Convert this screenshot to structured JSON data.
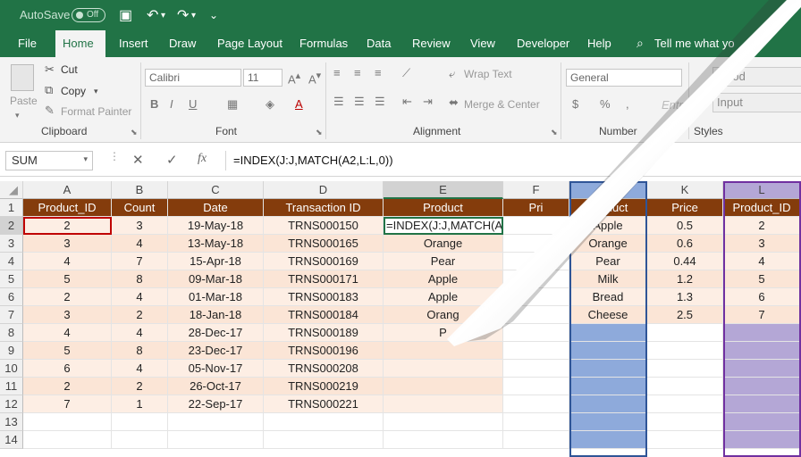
{
  "titlebar": {
    "autosave": "AutoSave",
    "toggle": "Off"
  },
  "tabs": [
    "File",
    "Home",
    "Insert",
    "Draw",
    "Page Layout",
    "Formulas",
    "Data",
    "Review",
    "View",
    "Developer",
    "Help",
    "Tell me what yo"
  ],
  "clipboard": {
    "paste": "Paste",
    "cut": "Cut",
    "copy": "Copy",
    "format_painter": "Format Painter",
    "label": "Clipboard"
  },
  "font": {
    "name": "Calibri",
    "size": "11",
    "label": "Font"
  },
  "alignment": {
    "wrap": "Wrap Text",
    "merge": "Merge & Center",
    "label": "Alignment"
  },
  "number": {
    "format": "General",
    "label": "Number"
  },
  "styles": {
    "good": "Good",
    "input": "Input",
    "label": "Styles",
    "tray": "Entry"
  },
  "formula_bar": {
    "name_box": "SUM",
    "formula": "=INDEX(J:J,MATCH(A2,L:L,0))"
  },
  "columns": [
    "A",
    "B",
    "C",
    "D",
    "E",
    "F",
    "J",
    "K",
    "L"
  ],
  "rows": [
    "1",
    "2",
    "3",
    "4",
    "5",
    "6",
    "7",
    "8",
    "9",
    "10",
    "11",
    "12",
    "13",
    "14"
  ],
  "main_header": [
    "Product_ID",
    "Count",
    "Date",
    "Transaction ID",
    "Product",
    "Pri"
  ],
  "main_rows": [
    [
      "2",
      "3",
      "19-May-18",
      "TRNS000150",
      "=INDEX(J:J,MATCH(A2"
    ],
    [
      "3",
      "4",
      "13-May-18",
      "TRNS000165",
      "Orange"
    ],
    [
      "4",
      "7",
      "15-Apr-18",
      "TRNS000169",
      "Pear"
    ],
    [
      "5",
      "8",
      "09-Mar-18",
      "TRNS000171",
      "Apple"
    ],
    [
      "2",
      "4",
      "01-Mar-18",
      "TRNS000183",
      "Apple"
    ],
    [
      "3",
      "2",
      "18-Jan-18",
      "TRNS000184",
      "Orang"
    ],
    [
      "4",
      "4",
      "28-Dec-17",
      "TRNS000189",
      "P"
    ],
    [
      "5",
      "8",
      "23-Dec-17",
      "TRNS000196",
      ""
    ],
    [
      "6",
      "4",
      "05-Nov-17",
      "TRNS000208",
      ""
    ],
    [
      "2",
      "2",
      "26-Oct-17",
      "TRNS000219",
      ""
    ],
    [
      "7",
      "1",
      "22-Sep-17",
      "TRNS000221",
      ""
    ]
  ],
  "lookup_header": [
    "Product",
    "Price",
    "Product_ID"
  ],
  "lookup_rows": [
    [
      "Apple",
      "0.5",
      "2"
    ],
    [
      "Orange",
      "0.6",
      "3"
    ],
    [
      "Pear",
      "0.44",
      "4"
    ],
    [
      "Milk",
      "1.2",
      "5"
    ],
    [
      "Bread",
      "1.3",
      "6"
    ],
    [
      "Cheese",
      "2.5",
      "7"
    ]
  ]
}
